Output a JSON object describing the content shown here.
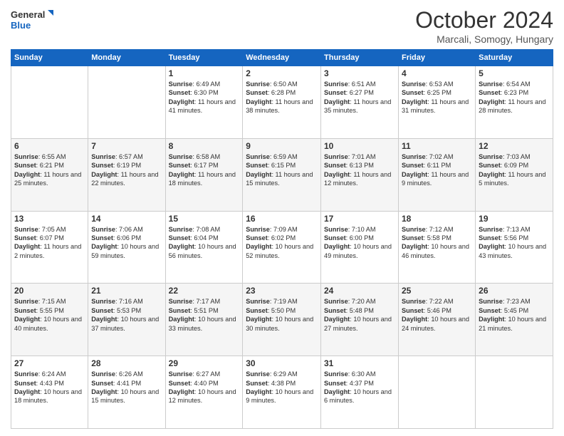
{
  "header": {
    "logo_line1": "General",
    "logo_line2": "Blue",
    "month_title": "October 2024",
    "subtitle": "Marcali, Somogy, Hungary"
  },
  "days_of_week": [
    "Sunday",
    "Monday",
    "Tuesday",
    "Wednesday",
    "Thursday",
    "Friday",
    "Saturday"
  ],
  "weeks": [
    [
      {
        "day": "",
        "info": ""
      },
      {
        "day": "",
        "info": ""
      },
      {
        "day": "1",
        "info": "Sunrise: 6:49 AM\nSunset: 6:30 PM\nDaylight: 11 hours and 41 minutes."
      },
      {
        "day": "2",
        "info": "Sunrise: 6:50 AM\nSunset: 6:28 PM\nDaylight: 11 hours and 38 minutes."
      },
      {
        "day": "3",
        "info": "Sunrise: 6:51 AM\nSunset: 6:27 PM\nDaylight: 11 hours and 35 minutes."
      },
      {
        "day": "4",
        "info": "Sunrise: 6:53 AM\nSunset: 6:25 PM\nDaylight: 11 hours and 31 minutes."
      },
      {
        "day": "5",
        "info": "Sunrise: 6:54 AM\nSunset: 6:23 PM\nDaylight: 11 hours and 28 minutes."
      }
    ],
    [
      {
        "day": "6",
        "info": "Sunrise: 6:55 AM\nSunset: 6:21 PM\nDaylight: 11 hours and 25 minutes."
      },
      {
        "day": "7",
        "info": "Sunrise: 6:57 AM\nSunset: 6:19 PM\nDaylight: 11 hours and 22 minutes."
      },
      {
        "day": "8",
        "info": "Sunrise: 6:58 AM\nSunset: 6:17 PM\nDaylight: 11 hours and 18 minutes."
      },
      {
        "day": "9",
        "info": "Sunrise: 6:59 AM\nSunset: 6:15 PM\nDaylight: 11 hours and 15 minutes."
      },
      {
        "day": "10",
        "info": "Sunrise: 7:01 AM\nSunset: 6:13 PM\nDaylight: 11 hours and 12 minutes."
      },
      {
        "day": "11",
        "info": "Sunrise: 7:02 AM\nSunset: 6:11 PM\nDaylight: 11 hours and 9 minutes."
      },
      {
        "day": "12",
        "info": "Sunrise: 7:03 AM\nSunset: 6:09 PM\nDaylight: 11 hours and 5 minutes."
      }
    ],
    [
      {
        "day": "13",
        "info": "Sunrise: 7:05 AM\nSunset: 6:07 PM\nDaylight: 11 hours and 2 minutes."
      },
      {
        "day": "14",
        "info": "Sunrise: 7:06 AM\nSunset: 6:06 PM\nDaylight: 10 hours and 59 minutes."
      },
      {
        "day": "15",
        "info": "Sunrise: 7:08 AM\nSunset: 6:04 PM\nDaylight: 10 hours and 56 minutes."
      },
      {
        "day": "16",
        "info": "Sunrise: 7:09 AM\nSunset: 6:02 PM\nDaylight: 10 hours and 52 minutes."
      },
      {
        "day": "17",
        "info": "Sunrise: 7:10 AM\nSunset: 6:00 PM\nDaylight: 10 hours and 49 minutes."
      },
      {
        "day": "18",
        "info": "Sunrise: 7:12 AM\nSunset: 5:58 PM\nDaylight: 10 hours and 46 minutes."
      },
      {
        "day": "19",
        "info": "Sunrise: 7:13 AM\nSunset: 5:56 PM\nDaylight: 10 hours and 43 minutes."
      }
    ],
    [
      {
        "day": "20",
        "info": "Sunrise: 7:15 AM\nSunset: 5:55 PM\nDaylight: 10 hours and 40 minutes."
      },
      {
        "day": "21",
        "info": "Sunrise: 7:16 AM\nSunset: 5:53 PM\nDaylight: 10 hours and 37 minutes."
      },
      {
        "day": "22",
        "info": "Sunrise: 7:17 AM\nSunset: 5:51 PM\nDaylight: 10 hours and 33 minutes."
      },
      {
        "day": "23",
        "info": "Sunrise: 7:19 AM\nSunset: 5:50 PM\nDaylight: 10 hours and 30 minutes."
      },
      {
        "day": "24",
        "info": "Sunrise: 7:20 AM\nSunset: 5:48 PM\nDaylight: 10 hours and 27 minutes."
      },
      {
        "day": "25",
        "info": "Sunrise: 7:22 AM\nSunset: 5:46 PM\nDaylight: 10 hours and 24 minutes."
      },
      {
        "day": "26",
        "info": "Sunrise: 7:23 AM\nSunset: 5:45 PM\nDaylight: 10 hours and 21 minutes."
      }
    ],
    [
      {
        "day": "27",
        "info": "Sunrise: 6:24 AM\nSunset: 4:43 PM\nDaylight: 10 hours and 18 minutes."
      },
      {
        "day": "28",
        "info": "Sunrise: 6:26 AM\nSunset: 4:41 PM\nDaylight: 10 hours and 15 minutes."
      },
      {
        "day": "29",
        "info": "Sunrise: 6:27 AM\nSunset: 4:40 PM\nDaylight: 10 hours and 12 minutes."
      },
      {
        "day": "30",
        "info": "Sunrise: 6:29 AM\nSunset: 4:38 PM\nDaylight: 10 hours and 9 minutes."
      },
      {
        "day": "31",
        "info": "Sunrise: 6:30 AM\nSunset: 4:37 PM\nDaylight: 10 hours and 6 minutes."
      },
      {
        "day": "",
        "info": ""
      },
      {
        "day": "",
        "info": ""
      }
    ]
  ]
}
